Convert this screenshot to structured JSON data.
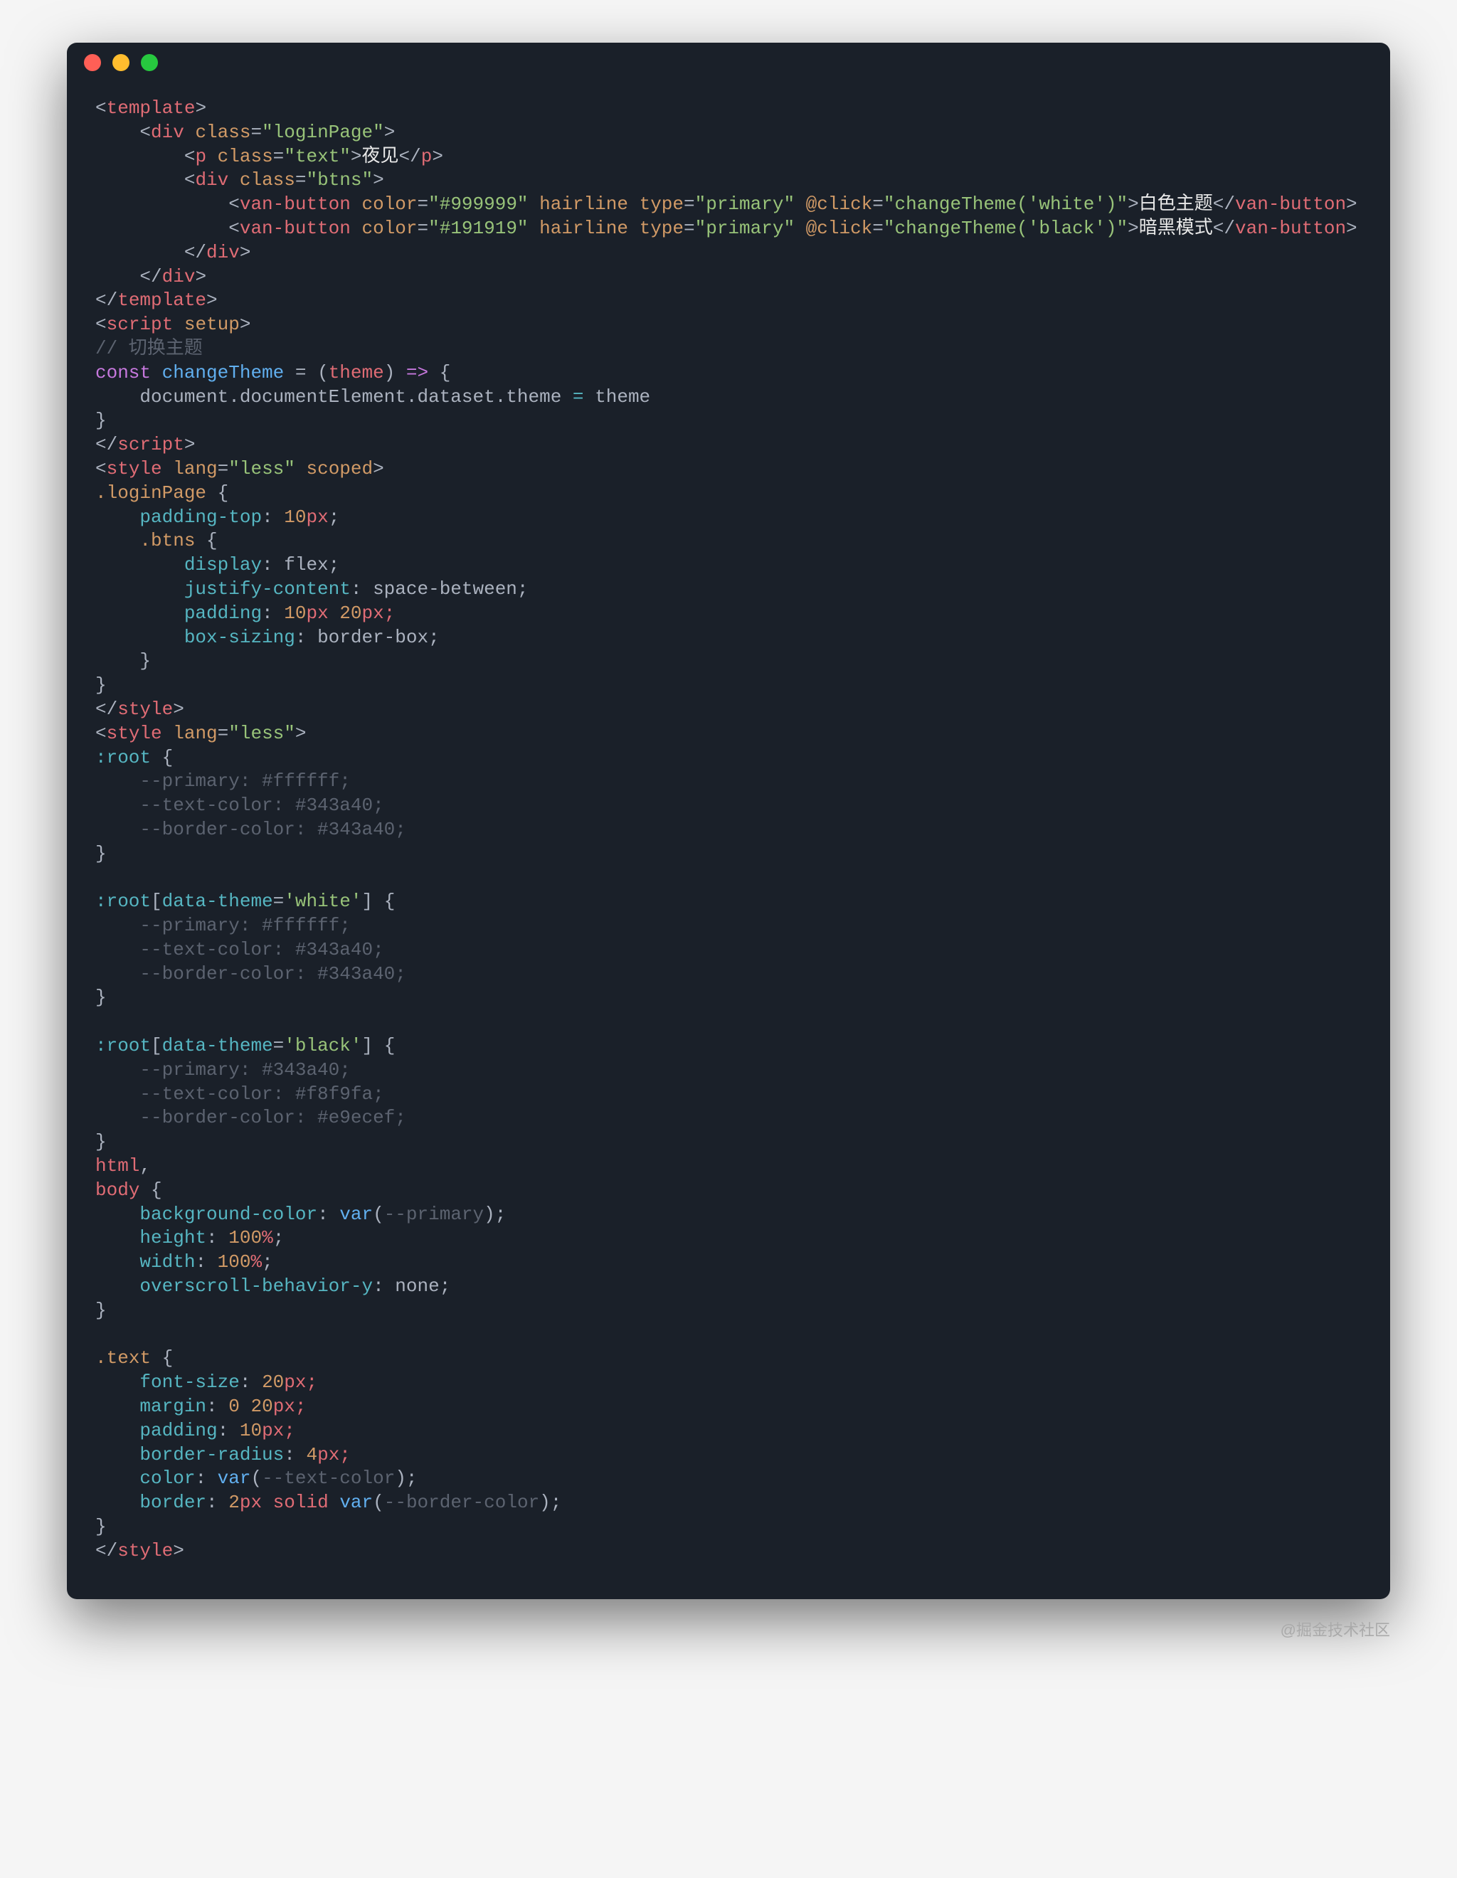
{
  "titlebar": {
    "buttons": [
      "close",
      "minimize",
      "zoom"
    ]
  },
  "watermark": "@掘金技术社区",
  "code": {
    "l1": {
      "a": "<",
      "b": "template",
      "c": ">"
    },
    "l2": {
      "a": "    <",
      "b": "div",
      "c": " ",
      "d": "class",
      "e": "=",
      "f": "\"loginPage\"",
      "g": ">"
    },
    "l3": {
      "a": "        <",
      "b": "p",
      "c": " ",
      "d": "class",
      "e": "=",
      "f": "\"text\"",
      "g": ">",
      "h": "夜见",
      "i": "</",
      "j": "p",
      "k": ">"
    },
    "l4": {
      "a": "        <",
      "b": "div",
      "c": " ",
      "d": "class",
      "e": "=",
      "f": "\"btns\"",
      "g": ">"
    },
    "l5": {
      "a": "            <",
      "b": "van-button",
      "c": " ",
      "d": "color",
      "e": "=",
      "f": "\"#999999\"",
      "g": " ",
      "h": "hairline",
      "i": " ",
      "j": "type",
      "k": "=",
      "l": "\"primary\"",
      "m": " ",
      "n": "@click",
      "o": "=",
      "p": "\"changeTheme('white')\"",
      "q": ">",
      "r": "白色主题",
      "s": "</",
      "t": "van-button",
      "u": ">"
    },
    "l6": {
      "a": "            <",
      "b": "van-button",
      "c": " ",
      "d": "color",
      "e": "=",
      "f": "\"#191919\"",
      "g": " ",
      "h": "hairline",
      "i": " ",
      "j": "type",
      "k": "=",
      "l": "\"primary\"",
      "m": " ",
      "n": "@click",
      "o": "=",
      "p": "\"changeTheme('black')\"",
      "q": ">",
      "r": "暗黑模式",
      "s": "</",
      "t": "van-button",
      "u": ">"
    },
    "l7": {
      "a": "        </",
      "b": "div",
      "c": ">"
    },
    "l8": {
      "a": "    </",
      "b": "div",
      "c": ">"
    },
    "l9": {
      "a": "</",
      "b": "template",
      "c": ">"
    },
    "l10": {
      "a": "<",
      "b": "script",
      "c": " ",
      "d": "setup",
      "e": ">"
    },
    "l11": {
      "a": "// 切换主题"
    },
    "l12": {
      "a": "const",
      "b": " ",
      "c": "changeTheme",
      "d": " = (",
      "e": "theme",
      "f": ") ",
      "g": "=>",
      "h": " {"
    },
    "l13": {
      "a": "    document.documentElement.dataset.theme ",
      "b": "=",
      "c": " theme"
    },
    "l14": {
      "a": "}"
    },
    "l15": {
      "a": "</",
      "b": "script",
      "c": ">"
    },
    "l16": {
      "a": "<",
      "b": "style",
      "c": " ",
      "d": "lang",
      "e": "=",
      "f": "\"less\"",
      "g": " ",
      "h": "scoped",
      "i": ">"
    },
    "l17": {
      "a": ".loginPage",
      "b": " {"
    },
    "l18": {
      "a": "    ",
      "b": "padding-top",
      "c": ": ",
      "d": "10",
      "e": "px",
      ";": ";"
    },
    "l19": {
      "a": "    ",
      "b": ".btns",
      "c": " {"
    },
    "l20": {
      "a": "        ",
      "b": "display",
      "c": ": flex;"
    },
    "l21": {
      "a": "        ",
      "b": "justify-content",
      "c": ": space-between;"
    },
    "l22": {
      "a": "        ",
      "b": "padding",
      "c": ": ",
      "d": "10",
      "e": "px ",
      "f": "20",
      "g": "px;"
    },
    "l23": {
      "a": "        ",
      "b": "box-sizing",
      "c": ": border-box;"
    },
    "l24": {
      "a": "    }"
    },
    "l25": {
      "a": "}"
    },
    "l26": {
      "a": "</",
      "b": "style",
      "c": ">"
    },
    "l27": {
      "a": "<",
      "b": "style",
      "c": " ",
      "d": "lang",
      "e": "=",
      "f": "\"less\"",
      "g": ">"
    },
    "l28": {
      "a": ":root",
      "b": " {"
    },
    "l29": {
      "a": "    --primary: #ffffff;"
    },
    "l30": {
      "a": "    --text-color: #343a40;"
    },
    "l31": {
      "a": "    --border-color: #343a40;"
    },
    "l32": {
      "a": "}"
    },
    "l33": {
      "a": ""
    },
    "l34": {
      "a": ":root",
      "b": "[",
      "c": "data-theme",
      "d": "=",
      "e": "'white'",
      "f": "] {"
    },
    "l35": {
      "a": "    --primary: #ffffff;"
    },
    "l36": {
      "a": "    --text-color: #343a40;"
    },
    "l37": {
      "a": "    --border-color: #343a40;"
    },
    "l38": {
      "a": "}"
    },
    "l39": {
      "a": ""
    },
    "l40": {
      "a": ":root",
      "b": "[",
      "c": "data-theme",
      "d": "=",
      "e": "'black'",
      "f": "] {"
    },
    "l41": {
      "a": "    --primary: #343a40;"
    },
    "l42": {
      "a": "    --text-color: #f8f9fa;"
    },
    "l43": {
      "a": "    --border-color: #e9ecef;"
    },
    "l44": {
      "a": "}"
    },
    "l45": {
      "a": "html",
      ",": ","
    },
    "l46": {
      "a": "body",
      "b": " {"
    },
    "l47": {
      "a": "    ",
      "b": "background-color",
      "c": ": ",
      "d": "var",
      "e": "(",
      "f": "--primary",
      "g": ");"
    },
    "l48": {
      "a": "    ",
      "b": "height",
      "c": ": ",
      "d": "100",
      "e": "%",
      ";": ";"
    },
    "l49": {
      "a": "    ",
      "b": "width",
      "c": ": ",
      "d": "100",
      "e": "%",
      ";": ";"
    },
    "l50": {
      "a": "    ",
      "b": "overscroll-behavior-y",
      "c": ": none;"
    },
    "l51": {
      "a": "}"
    },
    "l52": {
      "a": ""
    },
    "l53": {
      "a": ".text",
      "b": " {"
    },
    "l54": {
      "a": "    ",
      "b": "font-size",
      "c": ": ",
      "d": "20",
      "e": "px;"
    },
    "l55": {
      "a": "    ",
      "b": "margin",
      "c": ": ",
      "d": "0",
      "e": " ",
      "f": "20",
      "g": "px;"
    },
    "l56": {
      "a": "    ",
      "b": "padding",
      "c": ": ",
      "d": "10",
      "e": "px;"
    },
    "l57": {
      "a": "    ",
      "b": "border-radius",
      "c": ": ",
      "d": "4",
      "e": "px;"
    },
    "l58": {
      "a": "    ",
      "b": "color",
      "c": ": ",
      "d": "var",
      "e": "(",
      "f": "--text-color",
      "g": ");"
    },
    "l59": {
      "a": "    ",
      "b": "border",
      "c": ": ",
      "d": "2",
      "e": "px solid ",
      "f": "var",
      "g": "(",
      "h": "--border-color",
      "i": ");"
    },
    "l60": {
      "a": "}"
    },
    "l61": {
      "a": "</",
      "b": "style",
      "c": ">"
    }
  }
}
